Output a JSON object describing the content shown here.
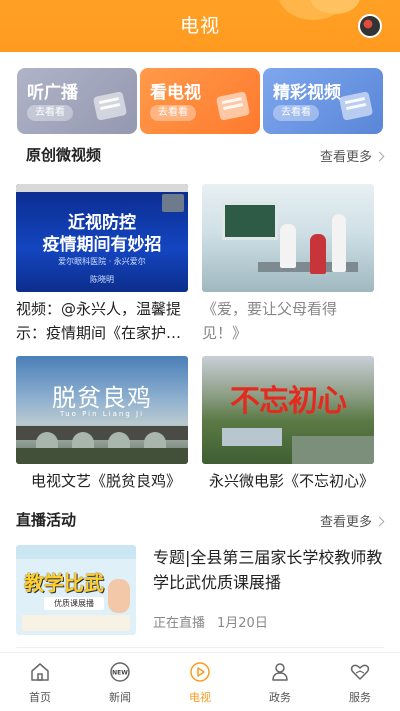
{
  "header": {
    "title": "电视"
  },
  "categories": [
    {
      "label": "听广播",
      "action": "去看看"
    },
    {
      "label": "看电视",
      "action": "去看看"
    },
    {
      "label": "精彩视频",
      "action": "去看看"
    }
  ],
  "original_video": {
    "title": "原创微视频",
    "more": "查看更多",
    "items": [
      {
        "caption": "视频：@永兴人，温馨提示：疫情期间《在家护…",
        "thumb": {
          "line1": "近视防控",
          "line2": "疫情期间有妙招",
          "sub": "爱尔眼科医院 · 永兴爱尔",
          "name": "陈晓明"
        }
      },
      {
        "caption": "《爱，要让父母看得见！》"
      },
      {
        "caption": "电视文艺《脱贫良鸡》",
        "thumb": {
          "title": "脱贫良鸡",
          "pinyin": "Tuo Pin Liang Ji"
        }
      },
      {
        "caption": "永兴微电影《不忘初心》",
        "thumb": {
          "title": "不忘初心"
        }
      }
    ]
  },
  "live": {
    "title": "直播活动",
    "more": "查看更多",
    "item": {
      "title": "专题|全县第三届家长学校教师教学比武优质课展播",
      "status": "正在直播",
      "date": "1月20日",
      "thumb": {
        "big": "教学比武",
        "btn": "优质课展播"
      }
    }
  },
  "nav": [
    {
      "label": "首页",
      "icon": "home-icon"
    },
    {
      "label": "新闻",
      "icon": "news-icon",
      "badge": "NEW"
    },
    {
      "label": "电视",
      "icon": "tv-play-icon",
      "active": true
    },
    {
      "label": "政务",
      "icon": "person-icon"
    },
    {
      "label": "服务",
      "icon": "heart-hand-icon"
    }
  ],
  "colors": {
    "accent": "#ff9a1f"
  }
}
